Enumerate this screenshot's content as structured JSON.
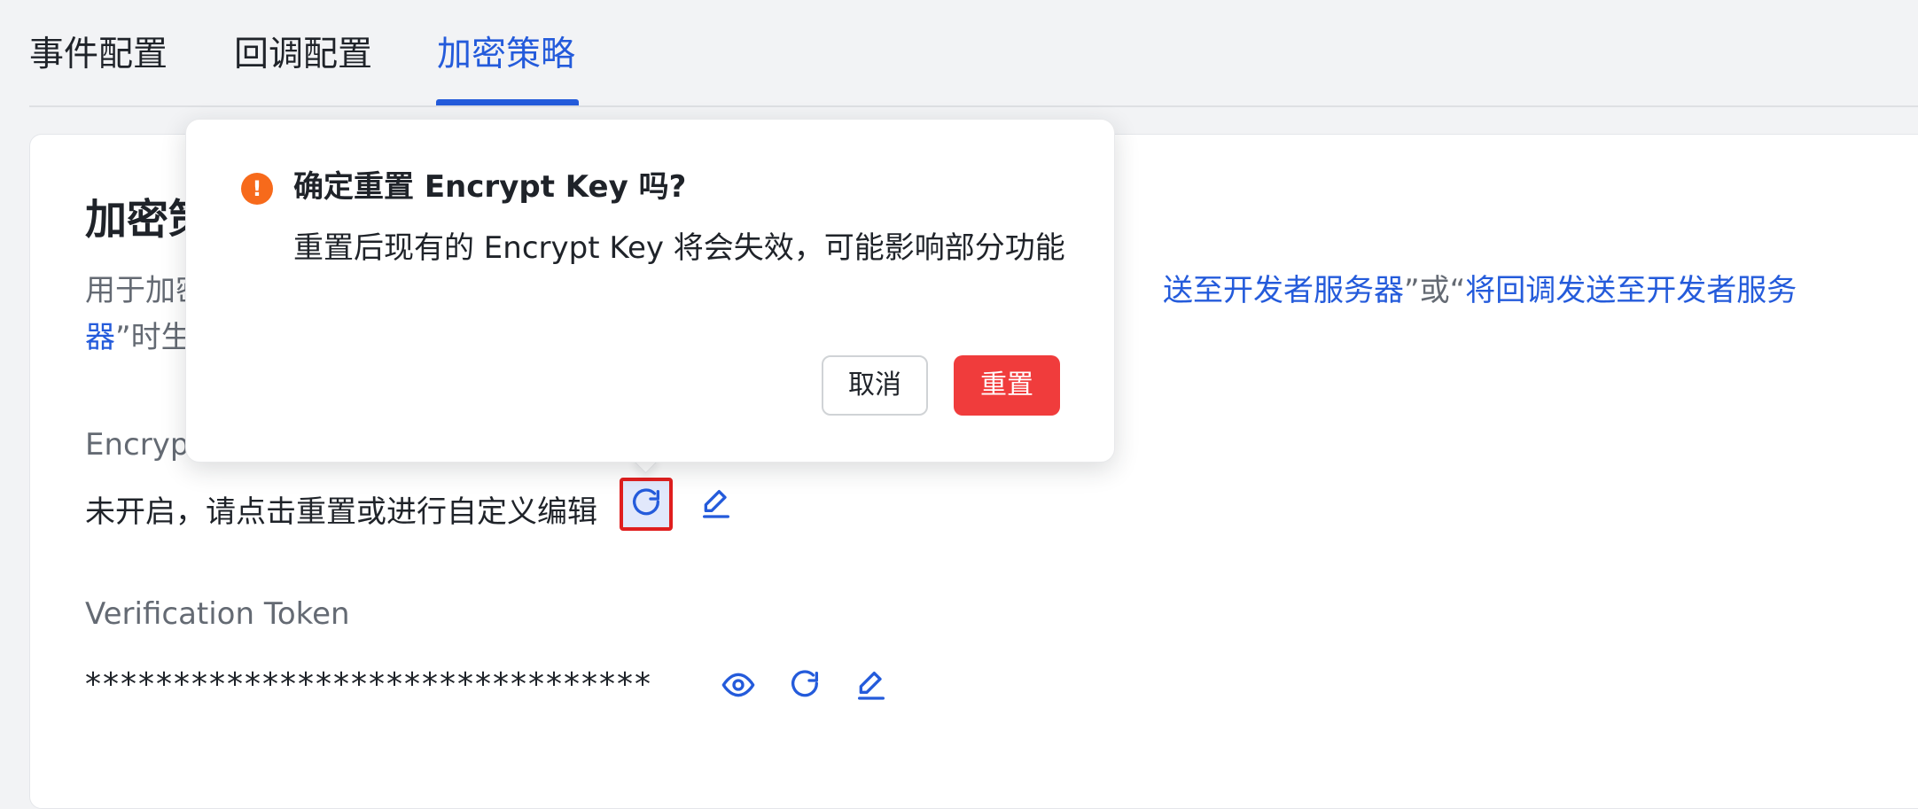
{
  "tabs": [
    {
      "label": "事件配置"
    },
    {
      "label": "回调配置"
    },
    {
      "label": "加密策略",
      "active": true
    }
  ],
  "card": {
    "title": "加密策",
    "description": {
      "part1": "用于加密",
      "link1": "送至开发者服务器",
      "mid": "”或“",
      "link2": "将回调发送至开发者服务器",
      "part2": "”时生效"
    },
    "encrypt_key": {
      "label": "Encryp",
      "status": "未开启，请点击重置或进行自定义编辑",
      "reset_icon": "refresh-icon",
      "edit_icon": "edit-icon"
    },
    "verification_token": {
      "label": "Verification Token",
      "value": "********************************",
      "view_icon": "eye-icon",
      "reset_icon": "refresh-icon",
      "edit_icon": "edit-icon"
    }
  },
  "popconfirm": {
    "icon": "warning-icon",
    "icon_glyph": "!",
    "title": "确定重置 Encrypt Key 吗?",
    "body": "重置后现有的 Encrypt Key 将会失效，可能影响部分功能",
    "cancel_label": "取消",
    "confirm_label": "重置"
  },
  "colors": {
    "accent": "#245bdb",
    "danger": "#f03c3c",
    "warning": "#f76a1b",
    "highlight_border": "#e01e1e"
  }
}
